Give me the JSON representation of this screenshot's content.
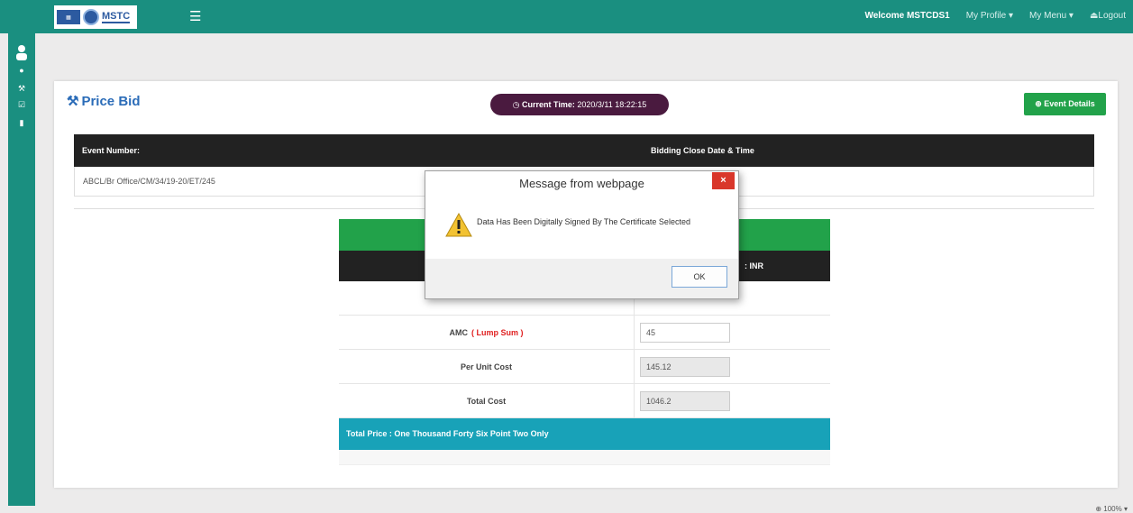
{
  "header": {
    "logo_text": "MSTC",
    "welcome": "Welcome MSTCDS1",
    "my_profile": "My Profile",
    "my_menu": "My Menu",
    "logout": "Logout",
    "hamburger_icon": "menu-icon"
  },
  "sidebar": {
    "items": [
      {
        "icon": "user-avatar-icon"
      },
      {
        "icon": "car-icon"
      },
      {
        "icon": "hammer-icon"
      },
      {
        "icon": "checklist-icon"
      },
      {
        "icon": "chart-icon"
      }
    ]
  },
  "page": {
    "title": "Price Bid",
    "clock_label": "Current Time:",
    "clock_value": "2020/3/11 18:22:15",
    "event_details": "Event Details"
  },
  "event": {
    "head_number": "Event Number:",
    "head_close": "Bidding Close Date & Time",
    "number": "ABCL/Br Office/CM/34/19-20/ET/245"
  },
  "bid": {
    "currency_label": ": INR",
    "rows": [
      {
        "label": "AMC",
        "note": "( Lump Sum )",
        "value": "45"
      },
      {
        "label": "Per Unit Cost",
        "value": "145.12"
      },
      {
        "label": "Total Cost",
        "value": "1046.2"
      }
    ],
    "total_text": "Total Price : One Thousand Forty Six Point Two Only"
  },
  "dialog": {
    "title": "Message from webpage",
    "message": "Data Has Been Digitally Signed By The Certificate Selected",
    "ok": "OK",
    "close": "×"
  },
  "statusbar": {
    "zoom": "100%"
  },
  "colors": {
    "teal": "#1a8f80",
    "green": "#22a24a",
    "clock_bg": "#4a1a3f",
    "total_bar": "#18a2b8",
    "title_blue": "#2b6cb8"
  }
}
